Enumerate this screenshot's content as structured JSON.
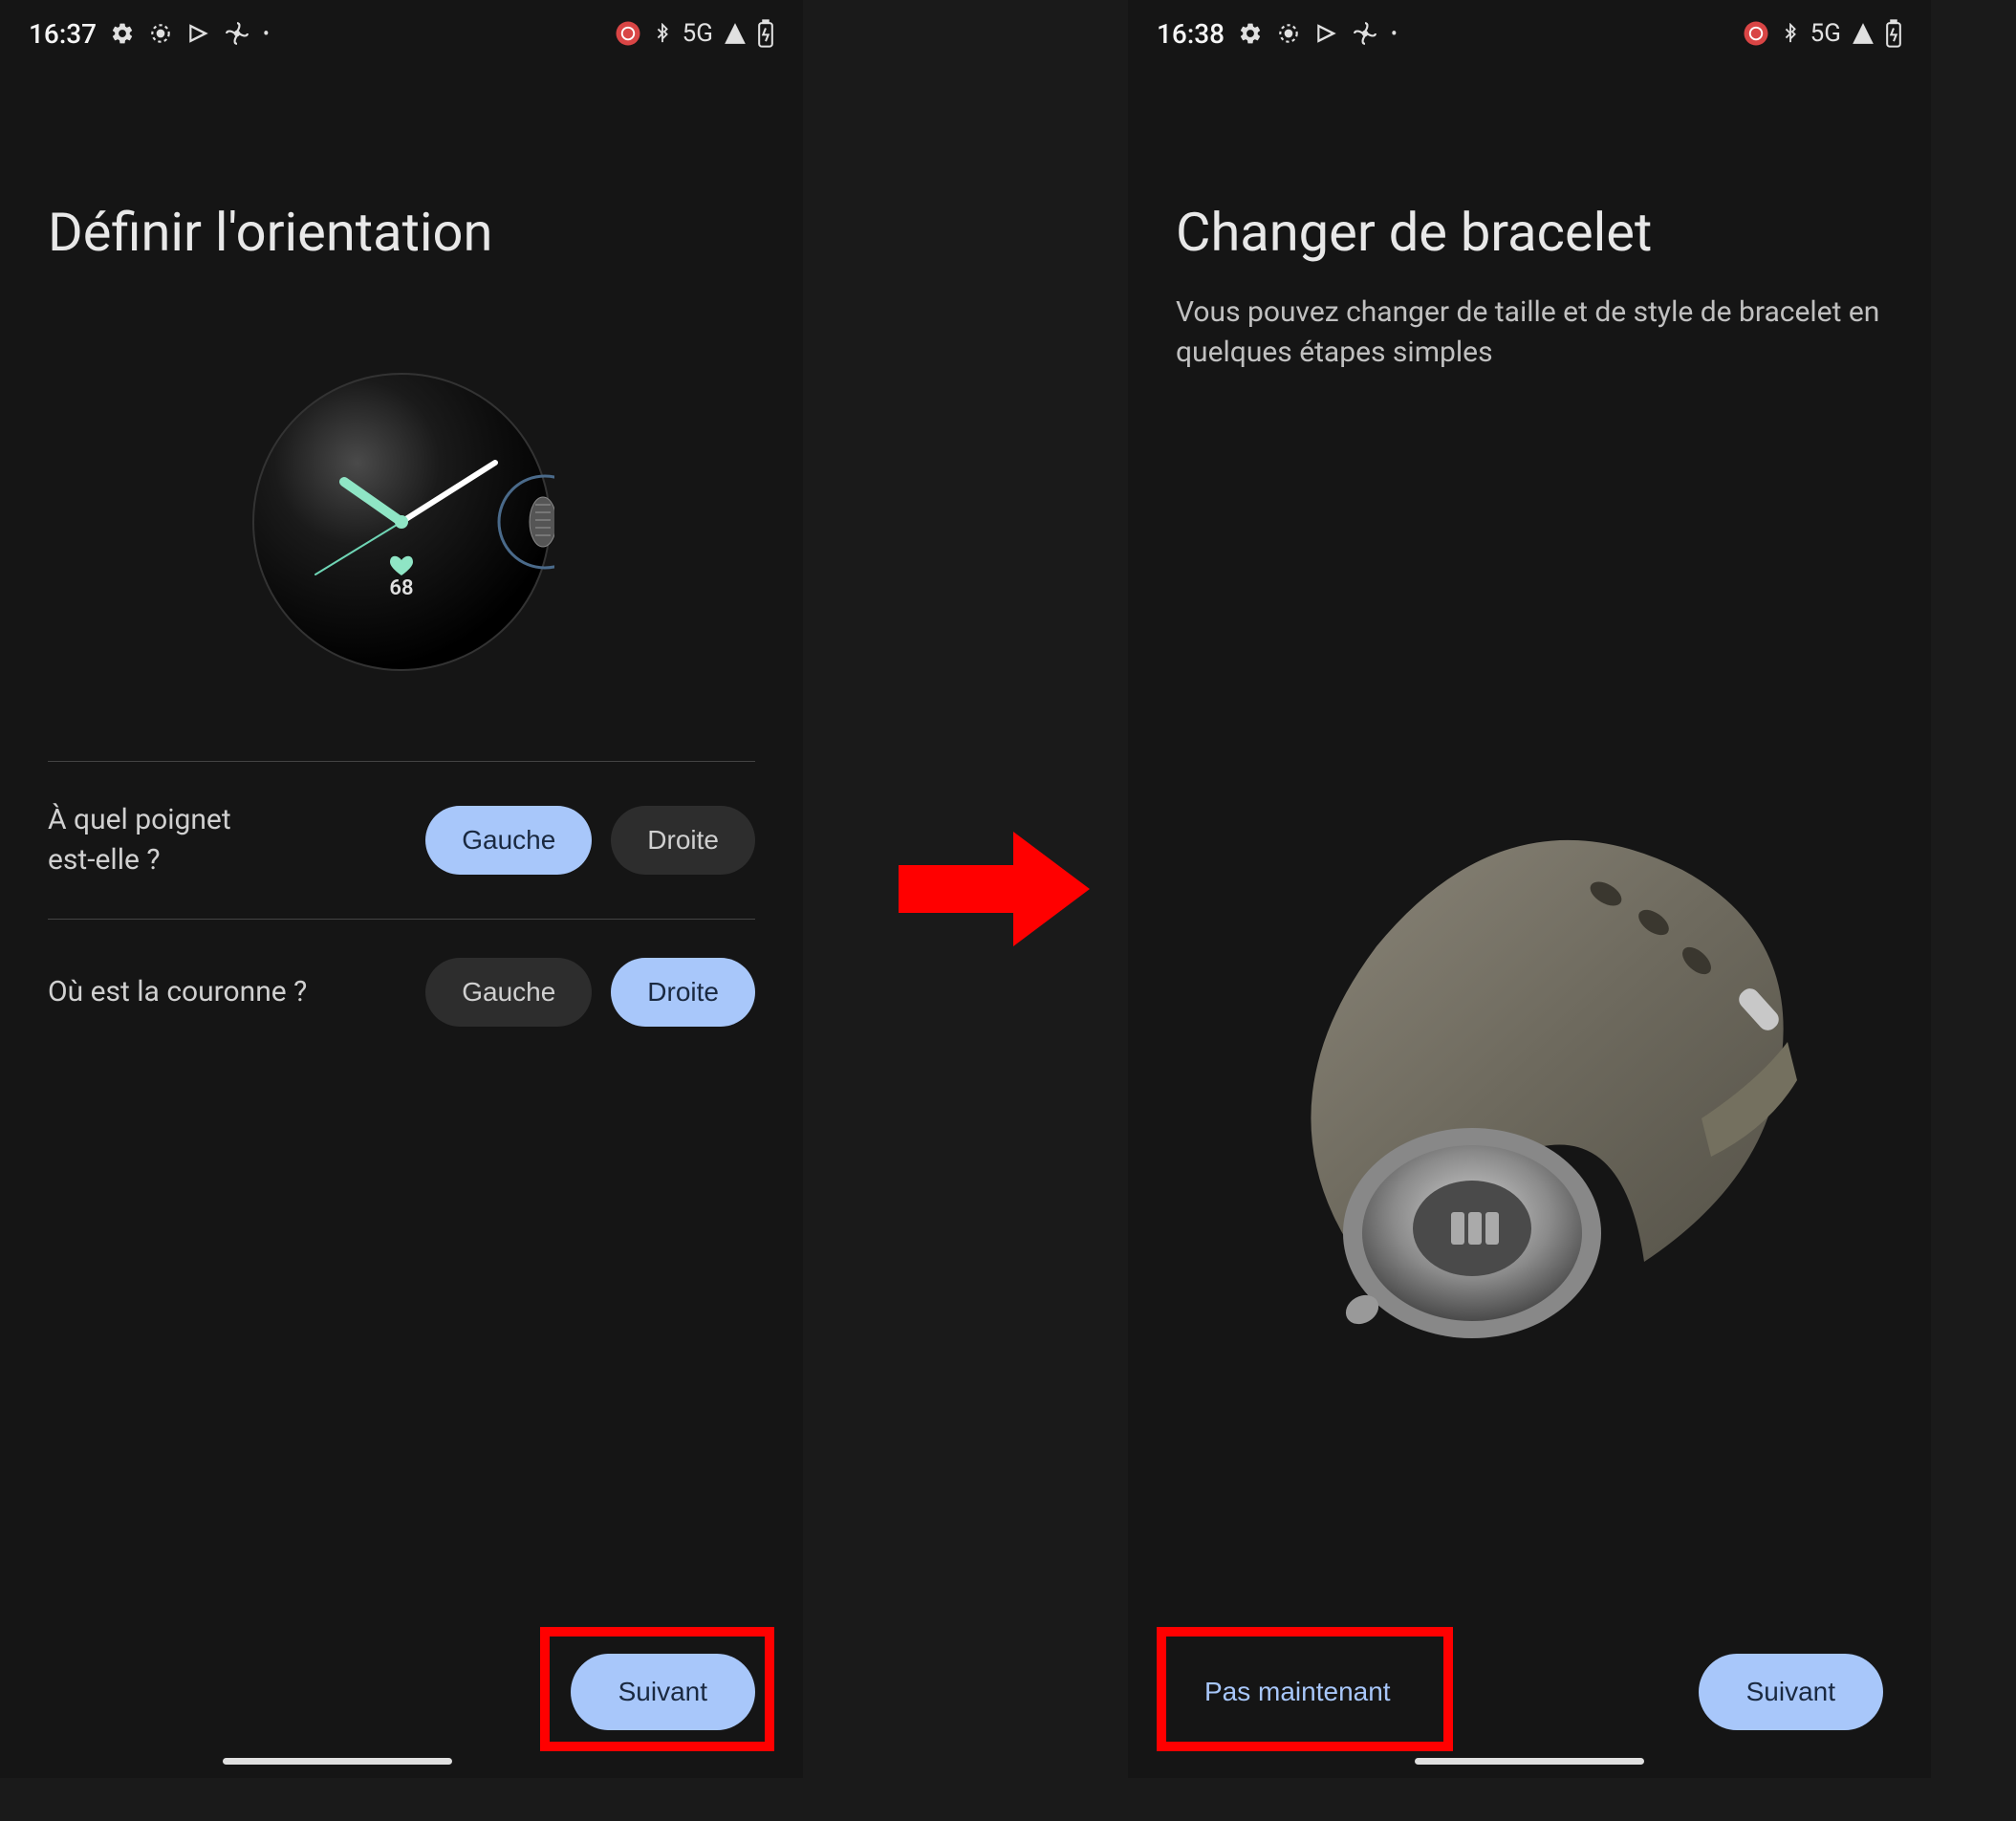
{
  "screen1": {
    "status": {
      "time": "16:37",
      "network": "5G"
    },
    "title": "Définir l'orientation",
    "watch": {
      "bpm": "68"
    },
    "setting1": {
      "label_line1": "À quel poignet",
      "label_line2": "est-elle ?",
      "opt_left": "Gauche",
      "opt_right": "Droite",
      "selected": "left"
    },
    "setting2": {
      "label": "Où est la couronne ?",
      "opt_left": "Gauche",
      "opt_right": "Droite",
      "selected": "right"
    },
    "next_btn": "Suivant"
  },
  "screen2": {
    "status": {
      "time": "16:38",
      "network": "5G"
    },
    "title": "Changer de bracelet",
    "subtitle": "Vous pouvez changer de taille et de style de bracelet en quelques étapes simples",
    "skip_btn": "Pas maintenant",
    "next_btn": "Suivant"
  }
}
